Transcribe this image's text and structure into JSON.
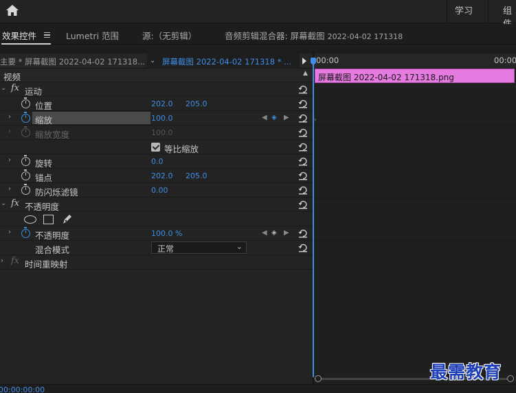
{
  "workspace": {
    "tabs": [
      {
        "label": "学习"
      },
      {
        "label": "组件"
      }
    ]
  },
  "panel_tabs": {
    "effect_controls": "效果控件",
    "lumetri_scopes": "Lumetri 范围",
    "source": "源:（无剪辑）",
    "audio_mixer": "音频剪辑混合器: 屏幕截图",
    "audio_mixer_sub": "2022-04-02 171318"
  },
  "source_bar": {
    "master": "主要 * 屏幕截图 2022-04-02 171318...",
    "sequence": "屏幕截图 2022-04-02 171318 * ..."
  },
  "section_video": "视频",
  "effects": {
    "motion": {
      "name": "运动",
      "position": {
        "label": "位置",
        "x": "202.0",
        "y": "205.0"
      },
      "scale": {
        "label": "缩放",
        "value": "100.0"
      },
      "scale_width": {
        "label": "缩放宽度",
        "value": "100.0"
      },
      "uniform_scale": {
        "label": "等比缩放",
        "checked": true
      },
      "rotation": {
        "label": "旋转",
        "value": "0.0"
      },
      "anchor": {
        "label": "锚点",
        "x": "202.0",
        "y": "205.0"
      },
      "anti_flicker": {
        "label": "防闪烁滤镜",
        "value": "0.00"
      }
    },
    "opacity": {
      "name": "不透明度",
      "opacity": {
        "label": "不透明度",
        "value": "100.0 %"
      },
      "blend_mode": {
        "label": "混合模式",
        "value": "正常"
      }
    },
    "time_remap": {
      "name": "时间重映射"
    }
  },
  "timeline": {
    "start": "00:00",
    "end": "00:00",
    "clip_name": "屏幕截图 2022-04-02  171318.png",
    "clip_color": "#e57ae0"
  },
  "status": {
    "timecode": "00:00:00:00"
  },
  "watermark": "最需教育",
  "colors": {
    "accent": "#3f8ee8",
    "panel": "#232323"
  }
}
